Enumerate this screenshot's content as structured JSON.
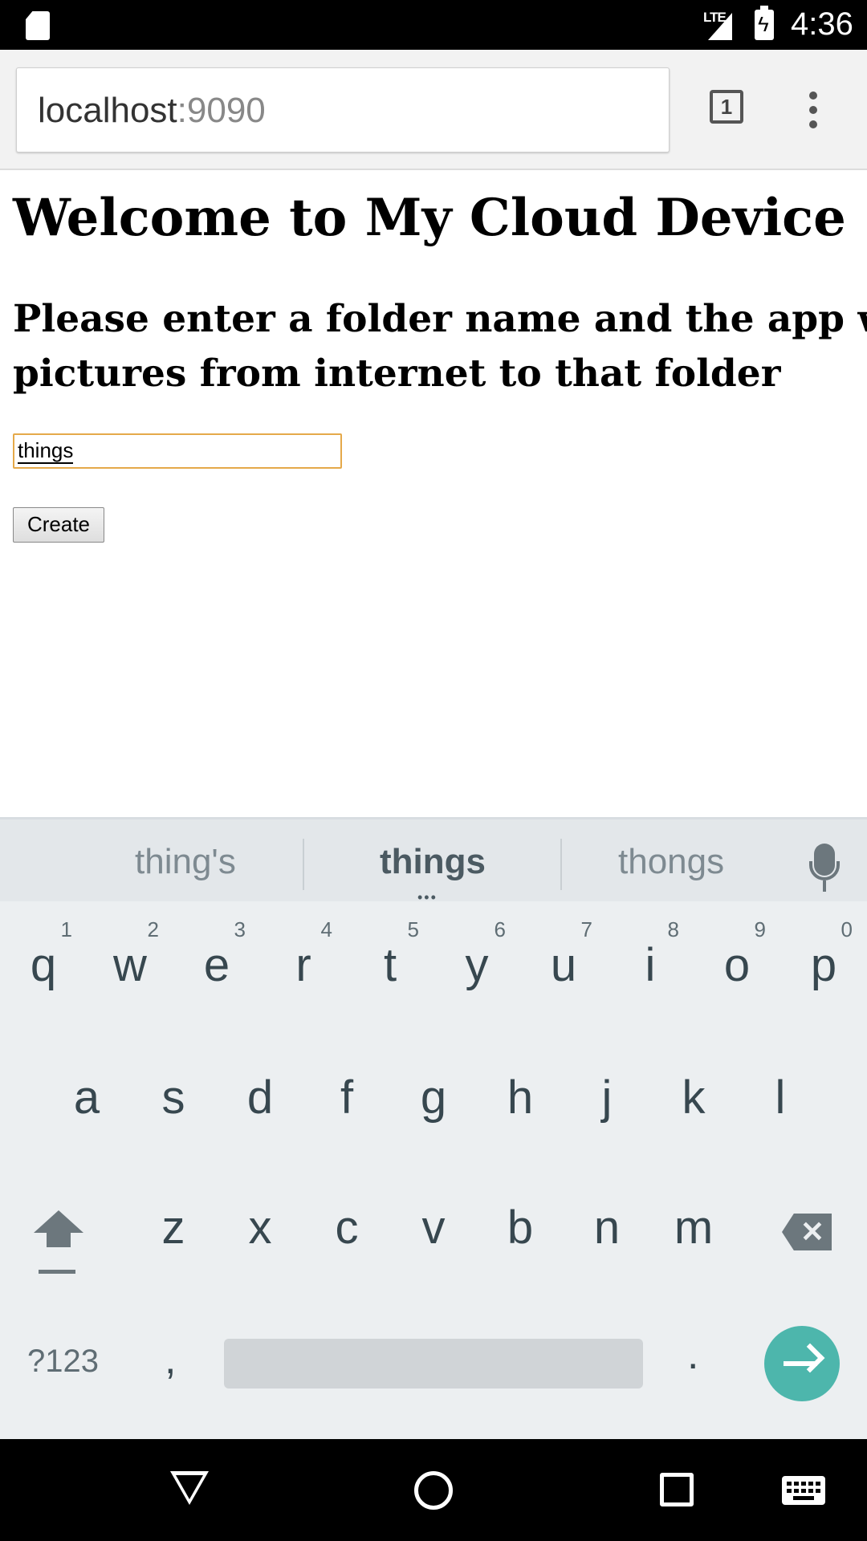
{
  "status_bar": {
    "network": "LTE",
    "time": "4:36",
    "icons": [
      "sd-card-icon",
      "signal-icon",
      "battery-charging-icon"
    ]
  },
  "browser": {
    "url_host": "localhost",
    "url_port": ":9090",
    "tab_count": "1",
    "icons": [
      "tabs-icon",
      "overflow-menu-icon"
    ]
  },
  "page": {
    "heading": "Welcome to My Cloud Device SI",
    "subheading": "Please enter a folder name and the app wi pictures from internet to that folder",
    "subheading_line1": "Please enter a folder name and the app wi",
    "subheading_line2": "pictures from internet to that folder",
    "folder_input_value": "things",
    "create_label": "Create"
  },
  "keyboard": {
    "suggestions": [
      "thing's",
      "things",
      "thongs"
    ],
    "row1": [
      {
        "ch": "q",
        "num": "1"
      },
      {
        "ch": "w",
        "num": "2"
      },
      {
        "ch": "e",
        "num": "3"
      },
      {
        "ch": "r",
        "num": "4"
      },
      {
        "ch": "t",
        "num": "5"
      },
      {
        "ch": "y",
        "num": "6"
      },
      {
        "ch": "u",
        "num": "7"
      },
      {
        "ch": "i",
        "num": "8"
      },
      {
        "ch": "o",
        "num": "9"
      },
      {
        "ch": "p",
        "num": "0"
      }
    ],
    "row2": [
      "a",
      "s",
      "d",
      "f",
      "g",
      "h",
      "j",
      "k",
      "l"
    ],
    "row3": [
      "z",
      "x",
      "c",
      "v",
      "b",
      "n",
      "m"
    ],
    "symbols_label": "?123",
    "comma": ",",
    "period": ".",
    "accent_color": "#4db6ac",
    "icons": [
      "mic-icon",
      "shift-icon",
      "backspace-icon",
      "go-arrow-icon"
    ]
  },
  "nav_bar": {
    "icons": [
      "back-icon",
      "home-icon",
      "recents-icon",
      "keyboard-switch-icon"
    ]
  }
}
